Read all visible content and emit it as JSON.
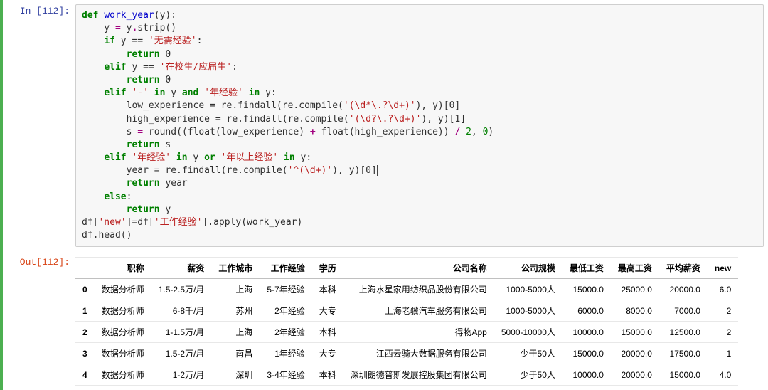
{
  "in_prompt": "In  [112]:",
  "out_prompt": "Out[112]:",
  "code": {
    "l1": {
      "def": "def",
      "name": "work_year",
      "op": "(y):"
    },
    "l2": "    y = y.strip()",
    "l3": {
      "if": "if",
      "rest": " y == ",
      "str": "'无需经验'",
      "colon": ":"
    },
    "l4": {
      "ret": "return",
      "val": " 0"
    },
    "l5": {
      "elif": "elif",
      "rest": " y == ",
      "str": "'在校生/应届生'",
      "colon": ":"
    },
    "l6": {
      "ret": "return",
      "val": " 0"
    },
    "l7": {
      "elif": "elif",
      "s1": "'-'",
      "in1": " in ",
      "mid": "y ",
      "and": "and",
      "s2": " '年经验' ",
      "in2": "in",
      "tail": " y:"
    },
    "l8": {
      "pre": "        low_experience = re.findall(re.compile(",
      "str": "'(\\d*\\.?\\d+)'",
      "post": "), y)[0]"
    },
    "l9": {
      "pre": "        high_experience = re.findall(re.compile(",
      "str": "'(\\d?\\.?\\d+)'",
      "post": "), y)[1]"
    },
    "l10": "        s = round((float(low_experience) + float(high_experience)) / 2, 0)",
    "l11": {
      "ret": "return",
      "val": " s"
    },
    "l12": {
      "elif": "elif",
      "s1": "'年经验'",
      "in1": " in ",
      "mid": "y ",
      "or": "or",
      "s2": " '年以上经验' ",
      "in2": "in",
      "tail": " y:"
    },
    "l13": {
      "pre": "        year = re.findall(re.compile(",
      "str": "'^(\\d+)'",
      "post": "), y)[0]"
    },
    "l14": {
      "ret": "return",
      "val": " year"
    },
    "l15": {
      "else": "else",
      "colon": ":"
    },
    "l16": {
      "ret": "return",
      "val": " y"
    },
    "l17": {
      "a": "df[",
      "s1": "'new'",
      "b": "]=df[",
      "s2": "'工作经验'",
      "c": "].apply(work_year)"
    },
    "l18": "df.head()"
  },
  "table": {
    "columns": [
      "职称",
      "薪资",
      "工作城市",
      "工作经验",
      "学历",
      "公司名称",
      "公司规模",
      "最低工资",
      "最高工资",
      "平均薪资",
      "new"
    ],
    "rows": [
      {
        "idx": "0",
        "cells": [
          "数据分析师",
          "1.5-2.5万/月",
          "上海",
          "5-7年经验",
          "本科",
          "上海水星家用纺织品股份有限公司",
          "1000-5000人",
          "15000.0",
          "25000.0",
          "20000.0",
          "6.0"
        ]
      },
      {
        "idx": "1",
        "cells": [
          "数据分析师",
          "6-8千/月",
          "苏州",
          "2年经验",
          "大专",
          "上海老骥汽车服务有限公司",
          "1000-5000人",
          "6000.0",
          "8000.0",
          "7000.0",
          "2"
        ]
      },
      {
        "idx": "2",
        "cells": [
          "数据分析师",
          "1-1.5万/月",
          "上海",
          "2年经验",
          "本科",
          "得物App",
          "5000-10000人",
          "10000.0",
          "15000.0",
          "12500.0",
          "2"
        ]
      },
      {
        "idx": "3",
        "cells": [
          "数据分析师",
          "1.5-2万/月",
          "南昌",
          "1年经验",
          "大专",
          "江西云骑大数据服务有限公司",
          "少于50人",
          "15000.0",
          "20000.0",
          "17500.0",
          "1"
        ]
      },
      {
        "idx": "4",
        "cells": [
          "数据分析师",
          "1-2万/月",
          "深圳",
          "3-4年经验",
          "本科",
          "深圳朗德普斯发展控股集团有限公司",
          "少于50人",
          "10000.0",
          "20000.0",
          "15000.0",
          "4.0"
        ]
      }
    ]
  }
}
